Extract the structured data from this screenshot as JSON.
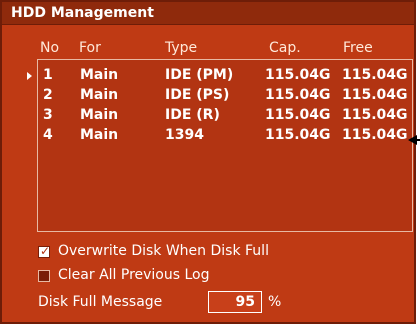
{
  "window": {
    "title": "HDD Management"
  },
  "columns": {
    "no": "No",
    "for": "For",
    "type": "Type",
    "cap": "Cap.",
    "free": "Free"
  },
  "disks": [
    {
      "no": "1",
      "for": "Main",
      "type": "IDE (PM)",
      "cap": "115.04G",
      "free": "115.04G"
    },
    {
      "no": "2",
      "for": "Main",
      "type": "IDE (PS)",
      "cap": "115.04G",
      "free": "115.04G"
    },
    {
      "no": "3",
      "for": "Main",
      "type": "IDE (R)",
      "cap": "115.04G",
      "free": "115.04G"
    },
    {
      "no": "4",
      "for": "Main",
      "type": "1394",
      "cap": "115.04G",
      "free": "115.04G"
    }
  ],
  "options": {
    "overwrite": {
      "label": "Overwrite Disk When Disk Full",
      "checked": true
    },
    "clear_log": {
      "label": "Clear All Previous Log",
      "checked": false
    }
  },
  "disk_full": {
    "label": "Disk Full Message",
    "value": "95",
    "unit": "%"
  },
  "colors": {
    "background": "#bf3a14",
    "titlebar": "#8f2a0c",
    "list": "#b23412",
    "text": "#ffffff"
  },
  "icons": {
    "selection": "selection-arrow-icon",
    "pointer": "pointer-arrow-icon",
    "check": "checkmark-icon"
  }
}
